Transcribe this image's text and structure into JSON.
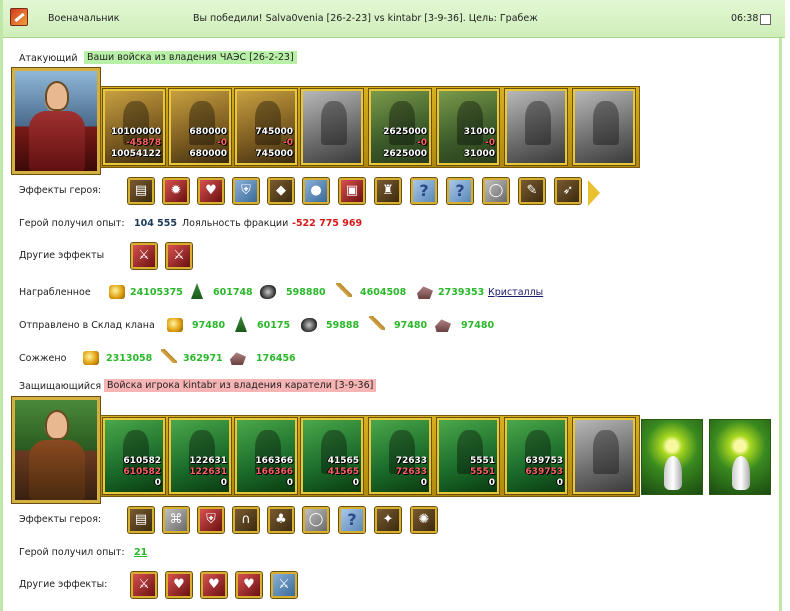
{
  "titlebar": {
    "name": "Военачальник",
    "summary": "Вы победили! Salva0venia [26-2-23] vs kintabr [3-9-36]. Цель: Грабеж",
    "time": "06:38"
  },
  "attacker": {
    "label": "Атакующий",
    "tag": "Ваши войска из владения ЧАЭС [26-2-23]",
    "troops": [
      {
        "n1": "10100000",
        "n2": "-45878",
        "n3": "10054122"
      },
      {
        "n1": "680000",
        "n2": "-0",
        "n3": "680000"
      },
      {
        "n1": "745000",
        "n2": "-0",
        "n3": "745000"
      },
      {
        "n1": "",
        "n2": "",
        "n3": ""
      },
      {
        "n1": "2625000",
        "n2": "-0",
        "n3": "2625000"
      },
      {
        "n1": "31000",
        "n2": "-0",
        "n3": "31000"
      },
      {
        "n1": "",
        "n2": "",
        "n3": ""
      },
      {
        "n1": "",
        "n2": "",
        "n3": ""
      }
    ],
    "effects_label": "Эффекты героя:",
    "effects_icons": [
      "book-icon",
      "fire-icon",
      "heart-icon",
      "shield-icon",
      "gem-icon",
      "orb-icon",
      "lantern-icon",
      "armor-icon",
      "question-icon",
      "question-icon",
      "ring-icon",
      "scroll-icon",
      "bow-icon"
    ],
    "effects_glyphs": [
      "▤",
      "✹",
      "♥",
      "⛨",
      "◆",
      "●",
      "▣",
      "♜",
      "?",
      "?",
      "◯",
      "✎",
      "➶"
    ],
    "xp_label": "Герой получил опыт:",
    "xp_value": "104 555",
    "loyalty_label": "Лояльность фракции",
    "loyalty_value": "-522 775 969",
    "other_label": "Другие эффекты",
    "other_glyphs": [
      "⚔",
      "⚔"
    ],
    "looted_label": "Награбленное",
    "looted": [
      "24105375",
      "601748",
      "598880",
      "4604508",
      "2739353"
    ],
    "crystals_link": "Кристаллы",
    "sent_label": "Отправлено в Склад клана",
    "sent": [
      "97480",
      "60175",
      "59888",
      "97480",
      "97480"
    ],
    "burned_label": "Сожжено",
    "burned": [
      "2313058",
      "362971",
      "176456"
    ]
  },
  "defender": {
    "label": "Защищающийся",
    "tag": "Войска игрока kintabr из владения каратели [3-9-36]",
    "troops": [
      {
        "n1": "610582",
        "n2": "610582",
        "n3": "0"
      },
      {
        "n1": "122631",
        "n2": "122631",
        "n3": "0"
      },
      {
        "n1": "166366",
        "n2": "166366",
        "n3": "0"
      },
      {
        "n1": "41565",
        "n2": "41565",
        "n3": "0"
      },
      {
        "n1": "72633",
        "n2": "72633",
        "n3": "0"
      },
      {
        "n1": "5551",
        "n2": "5551",
        "n3": "0"
      },
      {
        "n1": "639753",
        "n2": "639753",
        "n3": "0"
      },
      {
        "n1": "",
        "n2": "",
        "n3": ""
      }
    ],
    "effects_label": "Эффекты героя:",
    "effects_glyphs": [
      "▤",
      "⌘",
      "⛨",
      "∩",
      "♣",
      "◯",
      "?",
      "✦",
      "✺"
    ],
    "xp_label": "Герой получил опыт:",
    "xp_value": "21",
    "other_label": "Другие эффекты:",
    "other_glyphs": [
      "⚔",
      "♥",
      "♥",
      "♥",
      "⚔"
    ]
  }
}
